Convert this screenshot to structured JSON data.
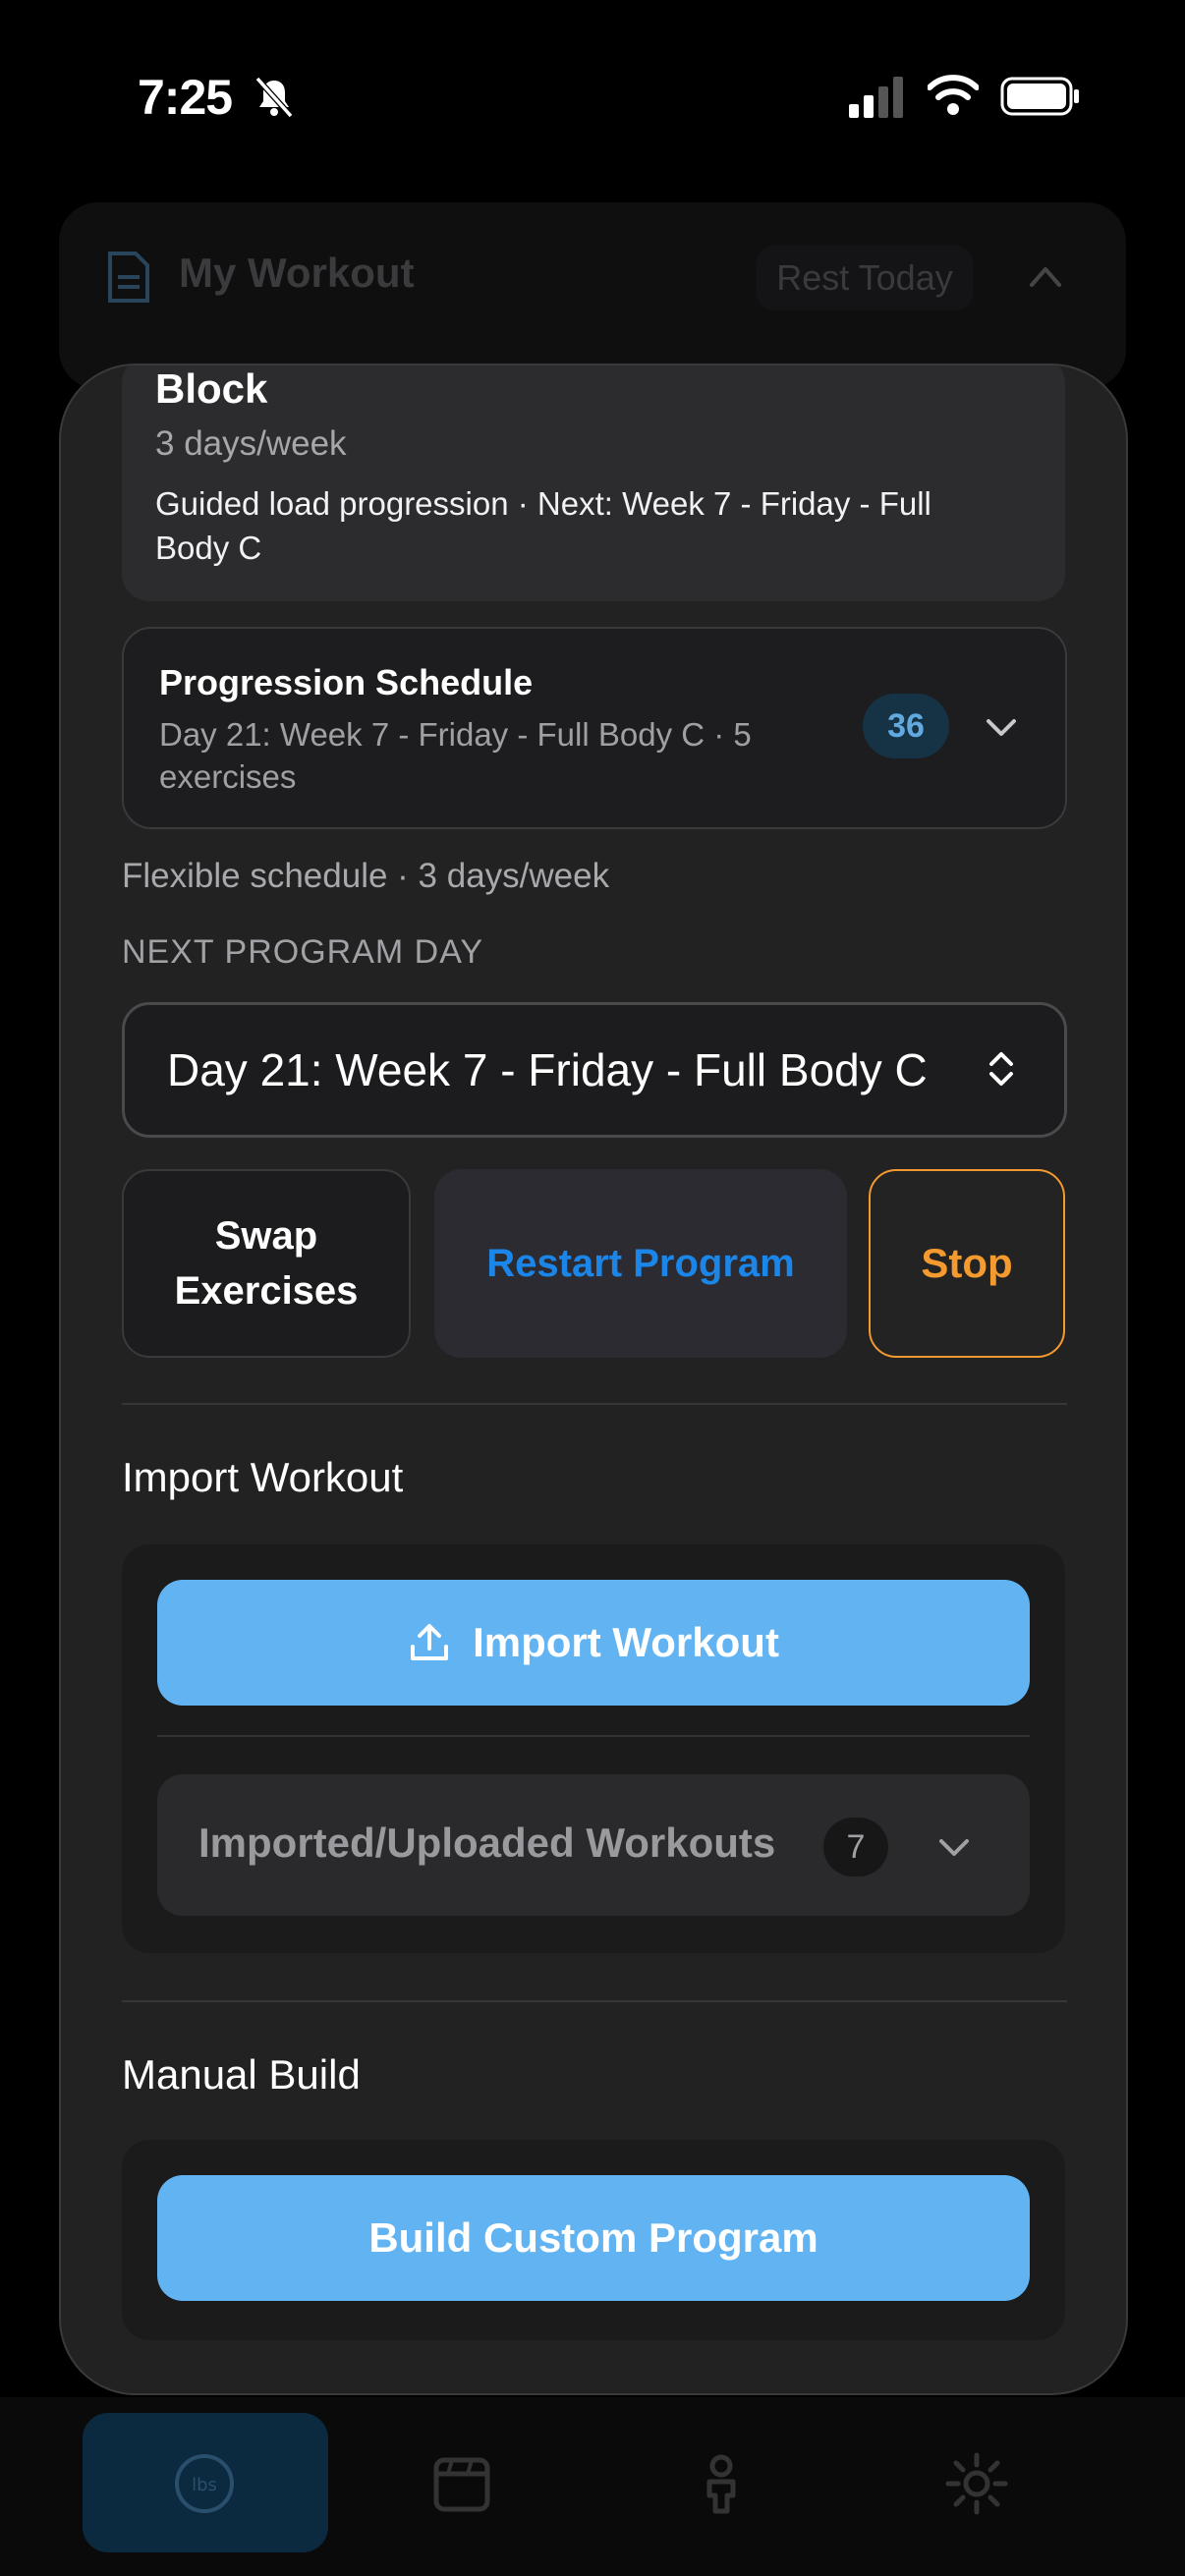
{
  "status_bar": {
    "time": "7:25"
  },
  "background_card": {
    "title": "My Workout",
    "rest_label": "Rest Today"
  },
  "block_card": {
    "title": "Block",
    "frequency": "3 days/week",
    "description": "Guided load progression · Next: Week 7 - Friday - Full Body C"
  },
  "progression": {
    "title": "Progression Schedule",
    "subtitle": "Day 21: Week 7 - Friday - Full Body C · 5 exercises",
    "count": "36"
  },
  "schedule_note": "Flexible schedule · 3 days/week",
  "next_program_day": {
    "label": "NEXT PROGRAM DAY",
    "selected": "Day 21: Week 7 - Friday - Full Body C"
  },
  "actions": {
    "swap": "Swap Exercises",
    "restart": "Restart Program",
    "stop": "Stop"
  },
  "import_section": {
    "title": "Import Workout",
    "button": "Import Workout",
    "imported_label": "Imported/Uploaded Workouts",
    "imported_count": "7"
  },
  "manual_section": {
    "title": "Manual Build",
    "button": "Build Custom Program"
  },
  "tabbar": {
    "items": [
      {
        "icon": "lbs-icon",
        "label": "lbs",
        "active": true
      },
      {
        "icon": "calendar-icon",
        "active": false
      },
      {
        "icon": "person-icon",
        "active": false
      },
      {
        "icon": "settings-sun-icon",
        "active": false
      }
    ]
  },
  "colors": {
    "accent_blue": "#62b3f2",
    "restart_blue": "#1b86e8",
    "stop_orange": "#f49a2e",
    "sheet_bg": "#222223"
  }
}
